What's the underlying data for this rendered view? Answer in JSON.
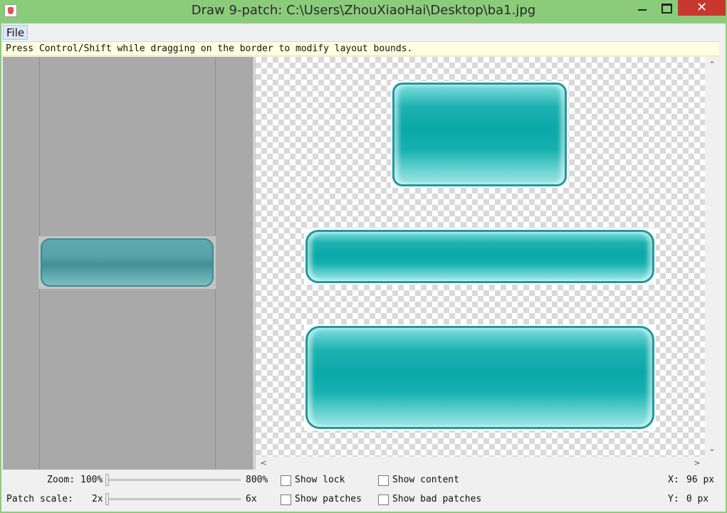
{
  "window": {
    "title": "Draw 9-patch: C:\\Users\\ZhouXiaoHai\\Desktop\\ba1.jpg",
    "close_glyph": "✕",
    "icons": [
      "java-app-icon",
      "minimize-icon",
      "maximize-icon",
      "close-icon"
    ]
  },
  "menu": {
    "file_label": "File"
  },
  "hint": {
    "text": "Press Control/Shift while dragging on the border to modify layout bounds."
  },
  "scroll": {
    "up": "⌃",
    "down": "⌄",
    "left": "<",
    "right": ">"
  },
  "controls": {
    "zoom": {
      "label": "Zoom:",
      "min": "100%",
      "max": "800%",
      "value": 0
    },
    "patch_scale": {
      "label": "Patch scale:",
      "min": "2x",
      "max": "6x",
      "value": 0
    },
    "show_lock": {
      "label": "Show lock",
      "checked": false
    },
    "show_patches": {
      "label": "Show patches",
      "checked": false
    },
    "show_content": {
      "label": "Show content",
      "checked": false
    },
    "show_bad_patches": {
      "label": "Show bad patches",
      "checked": false
    },
    "x_readout": {
      "label": "X:",
      "value": "96 px"
    },
    "y_readout": {
      "label": "Y:",
      "value": " 0 px"
    }
  },
  "colors": {
    "titlebar": "#8bcc7b",
    "close": "#c7372f",
    "preview_teal": "#0aa8a8",
    "source_teal": "#4f9ba0"
  }
}
